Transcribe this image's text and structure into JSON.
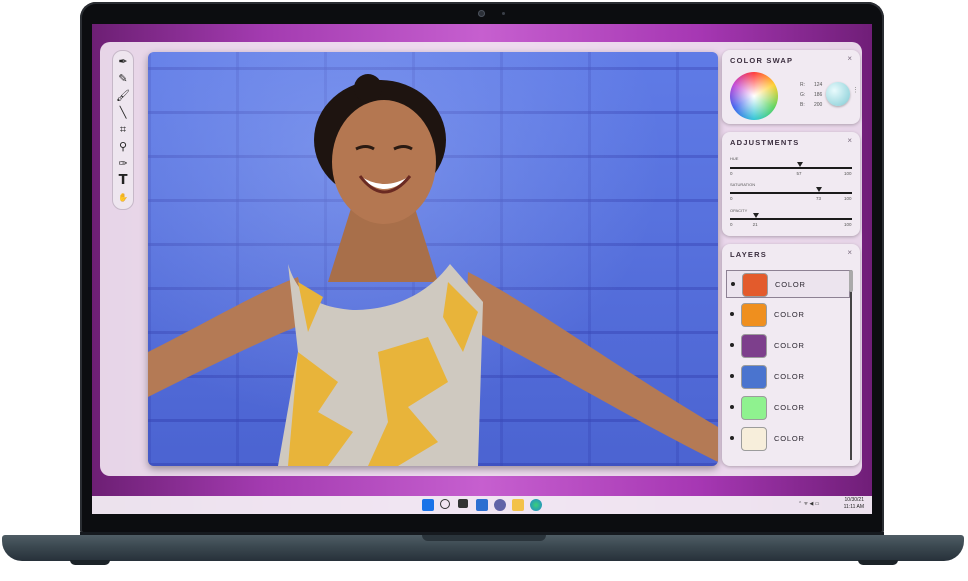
{
  "app": {
    "tools": [
      {
        "icon": "pen-icon",
        "glyph": "✒"
      },
      {
        "icon": "pen-nib-icon",
        "glyph": "✎"
      },
      {
        "icon": "brush-icon",
        "glyph": "🖌"
      },
      {
        "icon": "line-icon",
        "glyph": "╲"
      },
      {
        "icon": "crop-icon",
        "glyph": "⌗"
      },
      {
        "icon": "zoom-icon",
        "glyph": "⚲"
      },
      {
        "icon": "eyedropper-icon",
        "glyph": "✑"
      },
      {
        "icon": "text-tool-icon",
        "glyph": "T"
      },
      {
        "icon": "hand-icon",
        "glyph": "✋"
      }
    ]
  },
  "color_swap": {
    "title": "COLOR SWAP",
    "close": "×",
    "r_label": "R:",
    "r_value": "124",
    "g_label": "G:",
    "g_value": "186",
    "b_label": "B:",
    "b_value": "200",
    "stepper": "⋮",
    "selected_color": "#9fd9e0"
  },
  "adjustments": {
    "title": "ADJUSTMENTS",
    "close": "×",
    "sliders": [
      {
        "label": "HUE",
        "min": "0",
        "max": "100",
        "value": "57",
        "fraction": 0.57
      },
      {
        "label": "SATURATION",
        "min": "0",
        "max": "100",
        "value": "73",
        "fraction": 0.73
      },
      {
        "label": "OPACITY",
        "min": "0",
        "max": "100",
        "value": "21",
        "fraction": 0.21
      }
    ]
  },
  "layers": {
    "title": "LAYERS",
    "close": "×",
    "items": [
      {
        "label": "COLOR",
        "color": "#e35b2c",
        "selected": true
      },
      {
        "label": "COLOR",
        "color": "#ef8f1e",
        "selected": false
      },
      {
        "label": "COLOR",
        "color": "#7d3f8c",
        "selected": false
      },
      {
        "label": "COLOR",
        "color": "#4a74cf",
        "selected": false
      },
      {
        "label": "COLOR",
        "color": "#8ff28f",
        "selected": false
      },
      {
        "label": "COLOR",
        "color": "#f7eedb",
        "selected": false
      }
    ]
  },
  "taskbar": {
    "clock_time": "10/30/21",
    "clock_date": "11:11 AM",
    "tray_glyphs": "⌃  ᯤ  ◀  ▭"
  }
}
